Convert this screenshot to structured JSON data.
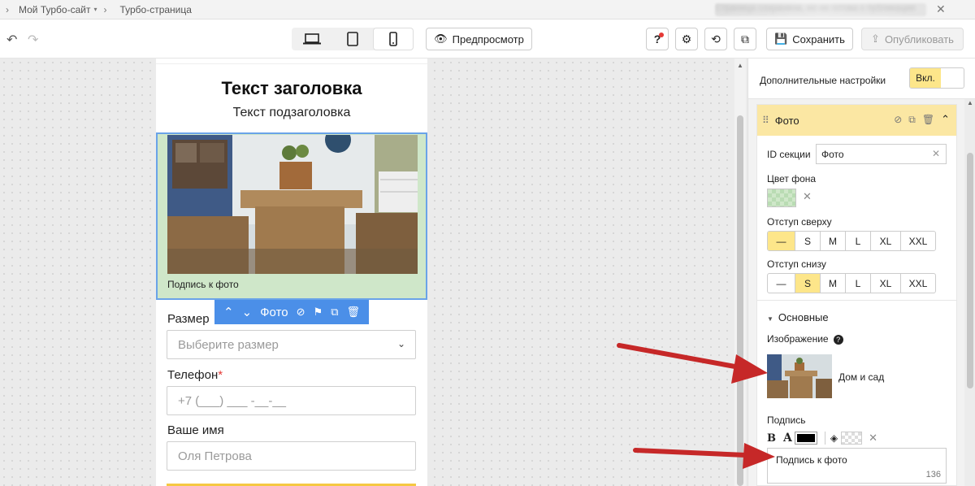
{
  "breadcrumb": {
    "site": "Мой Турбо-сайт",
    "page": "Турбо-страница",
    "blurred_notice": "Страница сохранена, но не готова к публикации"
  },
  "toolbar": {
    "preview_label": "Предпросмотр",
    "save_label": "Сохранить",
    "publish_label": "Опубликовать"
  },
  "page": {
    "title": "Текст заголовка",
    "subtitle": "Текст подзаголовка",
    "photo_caption": "Подпись к фото",
    "section_toolbar_label": "Фото",
    "fields": [
      {
        "label": "Размер",
        "placeholder": "Выберите размер",
        "required": false
      },
      {
        "label": "Телефон",
        "placeholder": "+7 (___) ___ -__-__",
        "required": true,
        "required_mark": "*"
      },
      {
        "label": "Ваше имя",
        "placeholder": "Оля Петрова",
        "required": false
      }
    ]
  },
  "panel": {
    "extra_settings_label": "Дополнительные настройки",
    "toggle_label": "Вкл.",
    "section_title": "Фото",
    "id_label": "ID секции",
    "id_value": "Фото",
    "bg_color_label": "Цвет фона",
    "bg_color": "#cfe7c9",
    "padding_top_label": "Отступ сверху",
    "padding_bottom_label": "Отступ снизу",
    "padding_options": [
      "—",
      "S",
      "M",
      "L",
      "XL",
      "XXL"
    ],
    "padding_top_selected": "—",
    "padding_bottom_selected": "S",
    "main_group_label": "Основные",
    "image_label": "Изображение",
    "image_help": "?",
    "image_name": "Дом и сад",
    "caption_label": "Подпись",
    "caption_value": "Подпись к фото",
    "caption_limit": "136",
    "caption_color": "#000000"
  },
  "colors": {
    "accent_yellow": "#fde68a",
    "selection_blue": "#4b8fe8",
    "annotation_red": "#c62828"
  }
}
